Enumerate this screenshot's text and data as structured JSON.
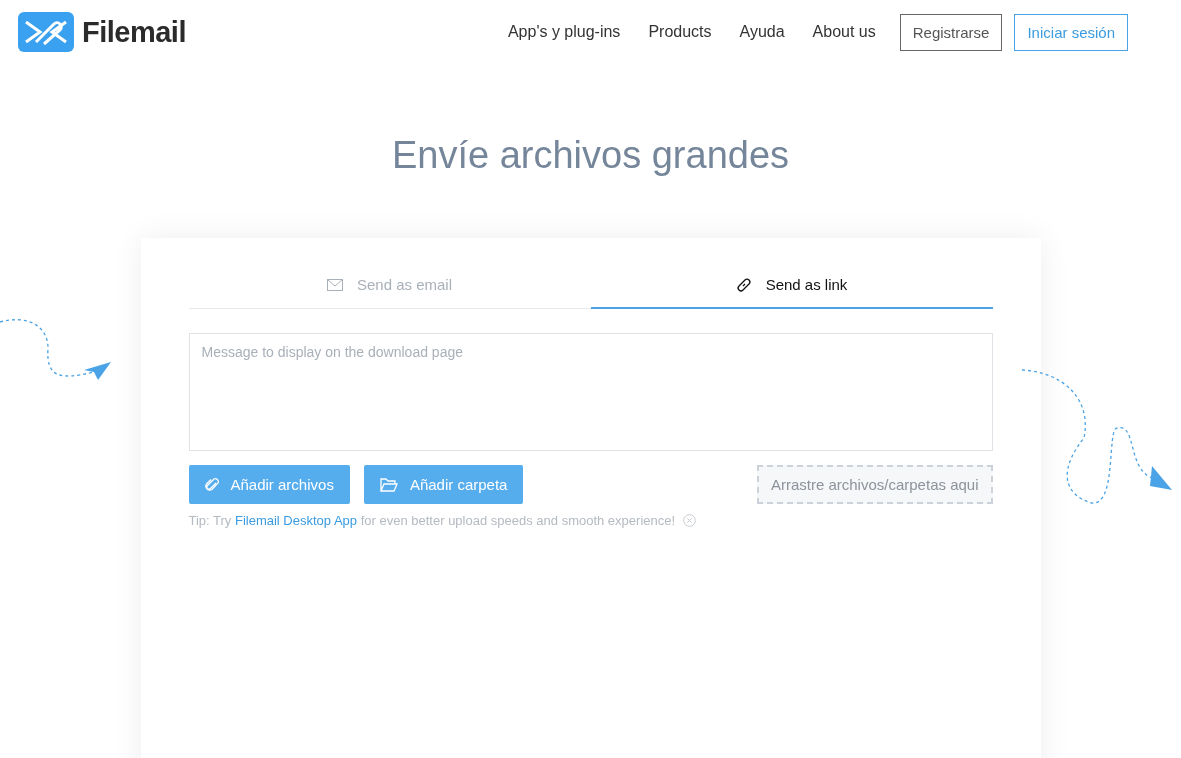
{
  "header": {
    "logo": "Filemail",
    "nav": [
      "App's y plug-ins",
      "Products",
      "Ayuda",
      "About us"
    ],
    "register_button": "Registrarse",
    "login_button": "Iniciar sesión"
  },
  "title": "Envíe archivos grandes",
  "tabs": [
    {
      "label": "Send as email",
      "kind": "email",
      "selected": false
    },
    {
      "label": "Send as link",
      "kind": "link",
      "selected": true
    }
  ],
  "message": {
    "placeholder": "Message to display on the download page"
  },
  "buttons": [
    {
      "label": "Añadir archivos",
      "kind": "files"
    },
    {
      "label": "Añadir carpeta",
      "kind": "folder"
    }
  ],
  "drop_zone": "Arrastre archivos/carpetas aqui",
  "tip": {
    "prefix": "Tip: Try",
    "link": "Filemail Desktop App",
    "suffix": "for even better upload speeds and smooth experience!"
  }
}
